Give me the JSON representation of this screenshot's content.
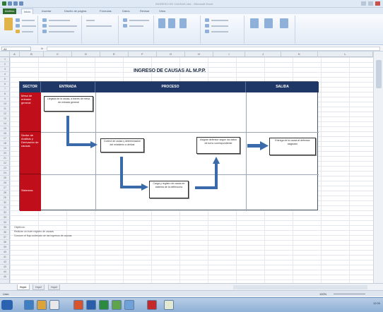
{
  "window": {
    "title": "INGRESO DE CAUSAS.xlsx - Microsoft Excel"
  },
  "ribbon_tabs": [
    "Archivo",
    "Inicio",
    "Insertar",
    "Diseño de página",
    "Fórmulas",
    "Datos",
    "Revisar",
    "Vista"
  ],
  "formula_bar": {
    "name_box": "A1",
    "fx": "fx",
    "value": ""
  },
  "columns": [
    "A",
    "B",
    "C",
    "D",
    "E",
    "F",
    "G",
    "H",
    "I",
    "J",
    "K",
    "L"
  ],
  "rows": [
    "1",
    "2",
    "3",
    "4",
    "5",
    "6",
    "7",
    "8",
    "9",
    "10",
    "11",
    "12",
    "13",
    "14",
    "15",
    "16",
    "17",
    "18",
    "19",
    "20",
    "21",
    "22",
    "23",
    "24",
    "25",
    "26",
    "27",
    "28",
    "29",
    "30",
    "31",
    "32",
    "33",
    "34",
    "35",
    "36",
    "37",
    "38",
    "39",
    "40",
    "41",
    "42",
    "43",
    "44",
    "45"
  ],
  "document": {
    "title": "INGRESO DE CAUSAS AL M.P.P.",
    "headers": {
      "sector": "SECTOR",
      "entrada": "ENTRADA",
      "proceso": "PROCESO",
      "salida": "SALIDA"
    },
    "lanes": [
      {
        "label": "Mesa de entrada general"
      },
      {
        "label": "Sector de Análisis y Derivación de causas"
      },
      {
        "label": "Sistemas"
      }
    ],
    "boxes": {
      "entrada": "Llegada de la causa, a través de mesa de entrada general",
      "control": "Control de causa y determinación del ministerio a derivar",
      "sistema": "Carga y registro de causa en sistema de la defensoría",
      "asignar": "Asignar defensor según los datos de turno correspondiente",
      "salida": "Entrega de la causa al defensor asignado"
    },
    "notes": [
      "Objetivos:",
      "Realizar un buen registro de causas",
      "Conocer el flujo ordenado de las ingresos de causas"
    ]
  },
  "sheet_tabs": [
    "Hoja1",
    "Hoja2",
    "Hoja3"
  ],
  "status": {
    "ready": "Listo",
    "zoom": "100%"
  },
  "taskbar": {
    "clock": "12:00"
  },
  "colors": {
    "header": "#1f3766",
    "lane": "#c00f1a",
    "arrow": "#3a6aaa"
  }
}
